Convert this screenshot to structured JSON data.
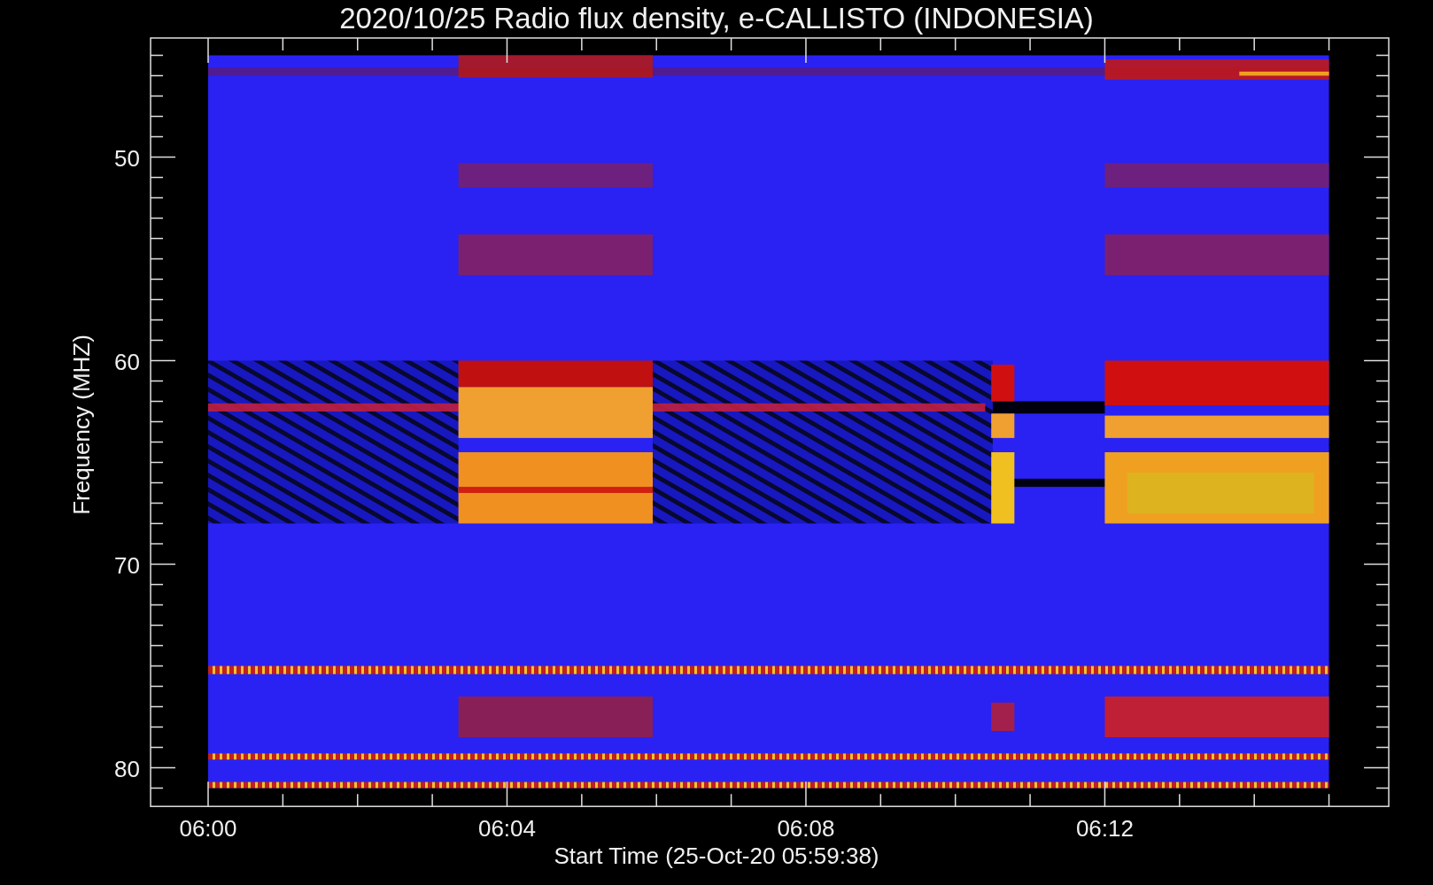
{
  "title": "2020/10/25  Radio flux density, e-CALLISTO (INDONESIA)",
  "y_axis": {
    "label": "Frequency (MHZ)",
    "tick_labels": [
      "50",
      "60",
      "70",
      "80"
    ]
  },
  "x_axis": {
    "label": "Start Time (25-Oct-20 05:59:38)",
    "tick_labels": [
      "06:00",
      "06:04",
      "06:08",
      "06:12"
    ]
  }
}
